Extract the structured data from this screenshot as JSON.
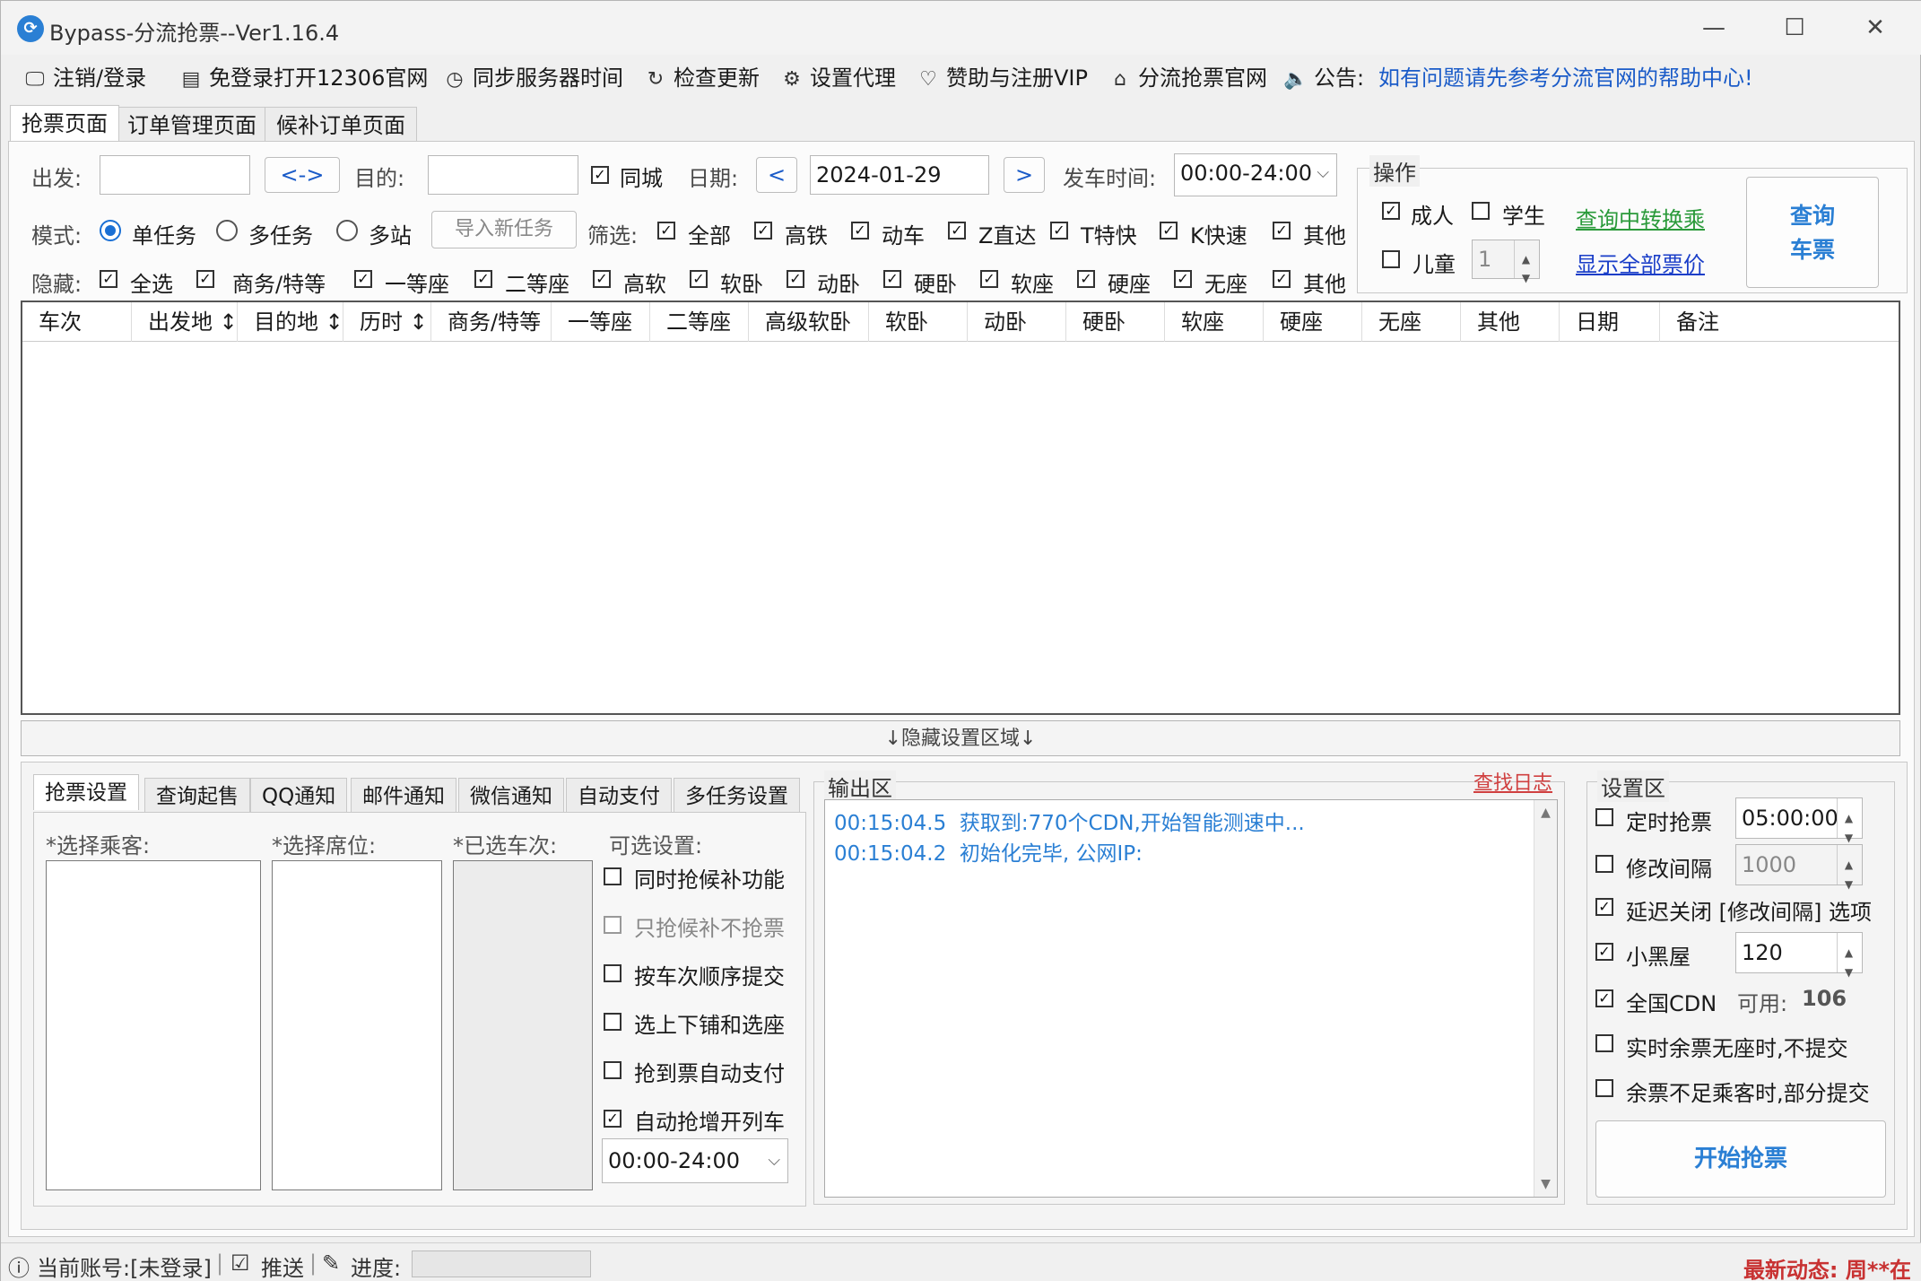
{
  "window": {
    "title": "Bypass-分流抢票--Ver1.16.4",
    "minimize": "—",
    "maximize": "☐",
    "close": "✕"
  },
  "toolbar": [
    {
      "icon": "monitor-icon",
      "glyph": "🖵",
      "label": "注销/登录"
    },
    {
      "icon": "browser-icon",
      "glyph": "▤",
      "label": "免登录打开12306官网"
    },
    {
      "icon": "clock-icon",
      "glyph": "◷",
      "label": "同步服务器时间"
    },
    {
      "icon": "refresh-icon",
      "glyph": "↻",
      "label": "检查更新"
    },
    {
      "icon": "gear-icon",
      "glyph": "⚙",
      "label": "设置代理"
    },
    {
      "icon": "heart-icon",
      "glyph": "♡",
      "label": "赞助与注册VIP"
    },
    {
      "icon": "home-icon",
      "glyph": "⌂",
      "label": "分流抢票官网"
    },
    {
      "icon": "speaker-icon",
      "glyph": "🔈",
      "label": "公告:"
    }
  ],
  "notice": "如有问题请先参考分流官网的帮助中心!",
  "main_tabs": [
    "抢票页面",
    "订单管理页面",
    "候补订单页面"
  ],
  "query": {
    "from_label": "出发:",
    "from_value": "",
    "swap_label": "<->",
    "to_label": "目的:",
    "to_value": "",
    "same_city_label": "同城",
    "date_label": "日期:",
    "prev": "<",
    "date_value": "2024-01-29",
    "next": ">",
    "depart_time_label": "发车时间:",
    "depart_time_value": "00:00-24:00"
  },
  "mode": {
    "label": "模式:",
    "options": [
      "单任务",
      "多任务",
      "多站"
    ],
    "import_label": "导入新任务"
  },
  "filter": {
    "label": "筛选:",
    "options": [
      "全部",
      "高铁",
      "动车",
      "Z直达",
      "T特快",
      "K快速",
      "其他"
    ]
  },
  "hide": {
    "label": "隐藏:",
    "options": [
      "全选",
      "商务/特等",
      "一等座",
      "二等座",
      "高软",
      "软卧",
      "动卧",
      "硬卧",
      "软座",
      "硬座",
      "无座",
      "其他"
    ]
  },
  "operate": {
    "title": "操作",
    "adult": "成人",
    "student": "学生",
    "child": "儿童",
    "child_count": "1",
    "transfer_link": "查询中转换乘",
    "show_price_link": "显示全部票价",
    "query_button_line1": "查询",
    "query_button_line2": "车票"
  },
  "grid_columns": [
    "车次",
    "出发地 ↕",
    "目的地 ↕",
    "历时 ↕",
    "商务/特等",
    "一等座",
    "二等座",
    "高级软卧",
    "软卧",
    "动卧",
    "硬卧",
    "软座",
    "硬座",
    "无座",
    "其他",
    "日期",
    "备注"
  ],
  "hide_settings": "↓隐藏设置区域↓",
  "settings_tabs": [
    "抢票设置",
    "查询起售",
    "QQ通知",
    "邮件通知",
    "微信通知",
    "自动支付",
    "多任务设置"
  ],
  "ticket_settings": {
    "passenger_label": "*选择乘客:",
    "seat_label": "*选择席位:",
    "train_label": "*已选车次:",
    "optional_label": "可选设置:",
    "options": [
      "同时抢候补功能",
      "只抢候补不抢票",
      "按车次顺序提交",
      "选上下铺和选座",
      "抢到票自动支付",
      "自动抢增开列车"
    ],
    "time_range": "00:00-24:00"
  },
  "output": {
    "title": "输出区",
    "find_log": "查找日志",
    "lines": [
      {
        "time": "00:15:04.5",
        "text": "获取到:770个CDN,开始智能测速中..."
      },
      {
        "time": "00:15:04.2",
        "text": "初始化完毕, 公网IP:"
      }
    ]
  },
  "settings_area": {
    "title": "设置区",
    "timed_label": "定时抢票",
    "timed_value": "05:00:00",
    "interval_label": "修改间隔",
    "interval_value": "1000",
    "delay_close_label": "延迟关闭 [修改间隔] 选项",
    "blackroom_label": "小黑屋",
    "blackroom_value": "120",
    "cdn_label": "全国CDN",
    "cdn_available_label": "可用:",
    "cdn_available_value": "106",
    "realtime_label": "实时余票无座时,不提交",
    "partial_label": "余票不足乘客时,部分提交",
    "start_button": "开始抢票"
  },
  "status": {
    "account": "当前账号:[未登录]",
    "push": "推送",
    "progress_label": "进度:",
    "news": "最新动态: 周**在"
  },
  "colors": {
    "accent": "#1a6fd4",
    "link_green": "#2a9a3a",
    "log_blue": "#2a7fd4",
    "alert_red": "#c83232"
  }
}
